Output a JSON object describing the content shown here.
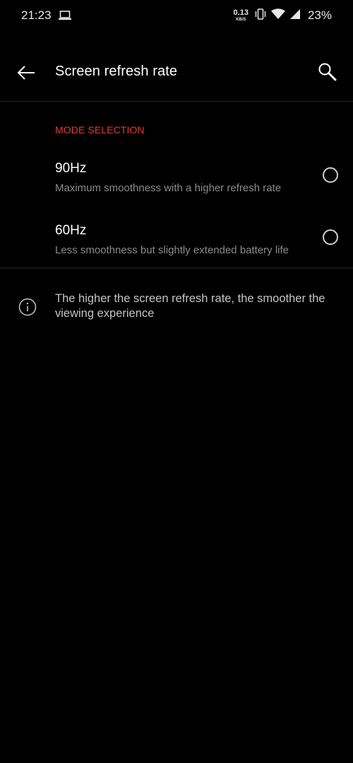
{
  "status_bar": {
    "time": "21:23",
    "netspeed_value": "0.13",
    "netspeed_unit": "KB/S",
    "battery": "23%",
    "icons": [
      "laptop-icon",
      "vibrate-icon",
      "wifi-icon",
      "signal-icon"
    ]
  },
  "app_bar": {
    "title": "Screen refresh rate",
    "back_icon": "arrow-left-icon",
    "search_icon": "search-icon"
  },
  "section": {
    "header": "MODE SELECTION",
    "header_color": "#e53935",
    "options": [
      {
        "title": "90Hz",
        "subtitle": "Maximum smoothness with a higher refresh rate",
        "selected": false
      },
      {
        "title": "60Hz",
        "subtitle": "Less smoothness but slightly extended battery life",
        "selected": false
      }
    ]
  },
  "info": {
    "icon": "info-icon",
    "text": "The higher the screen refresh rate, the smoother the viewing experience"
  }
}
